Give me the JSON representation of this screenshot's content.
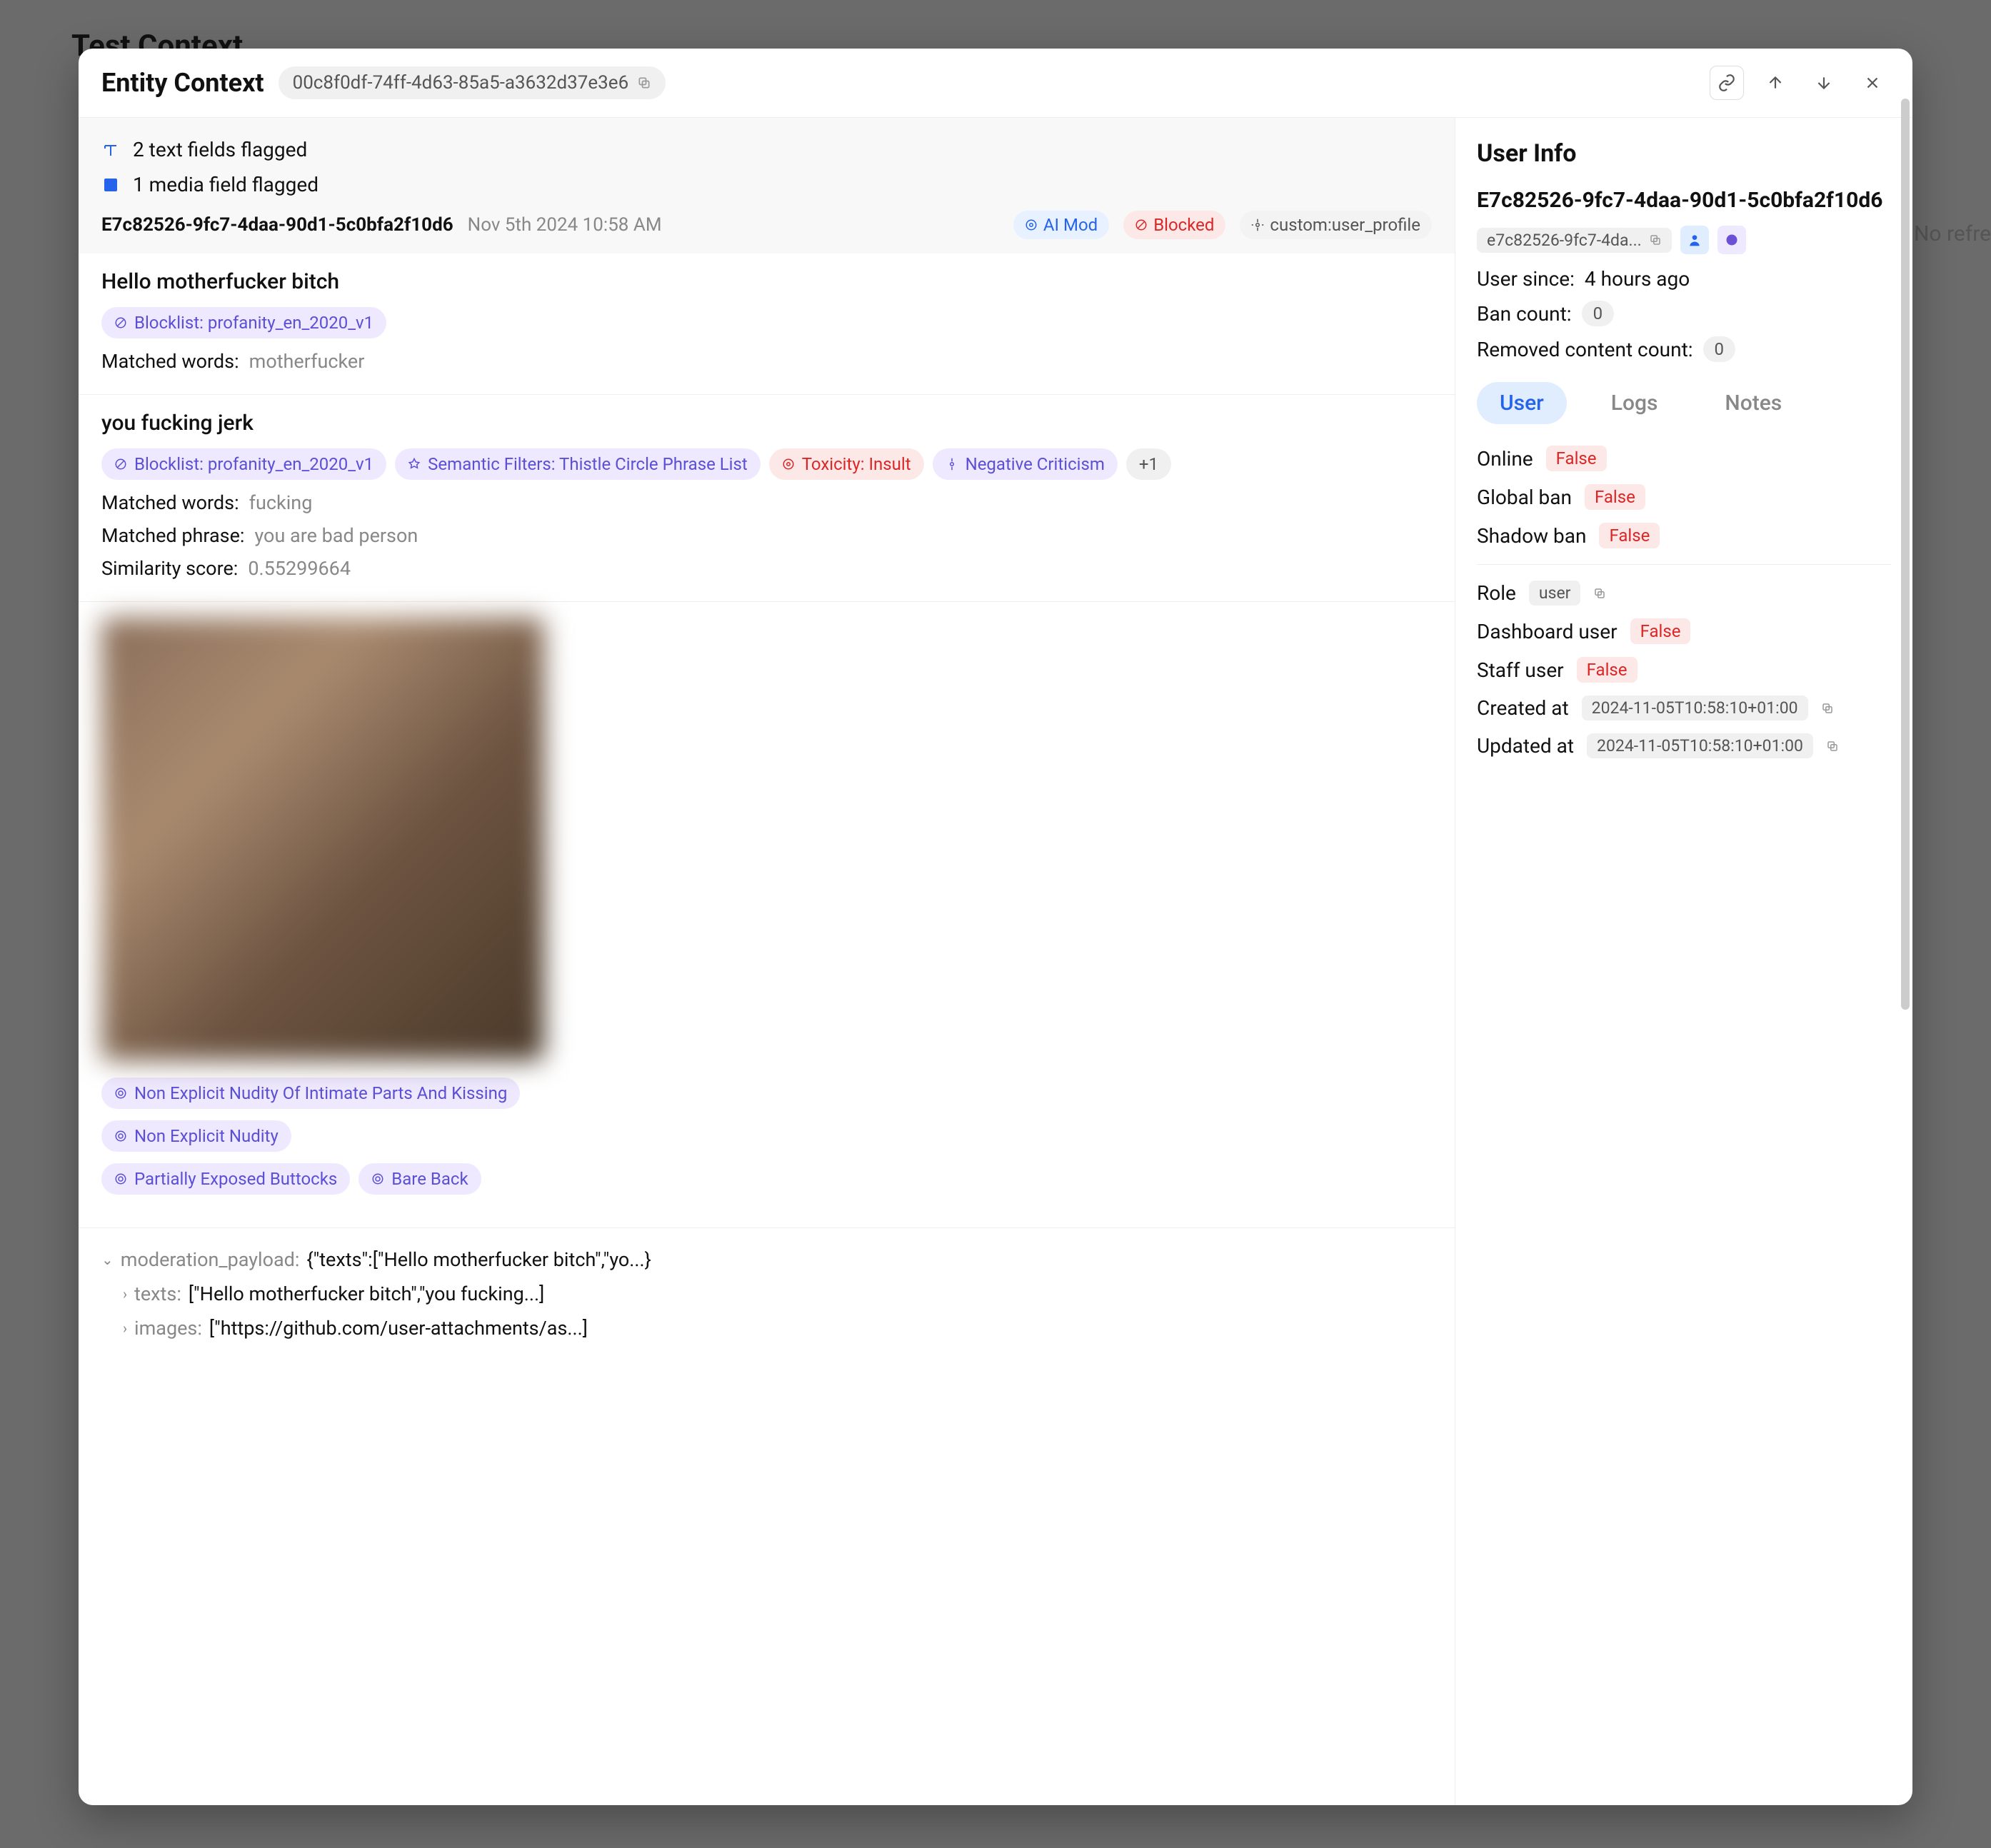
{
  "bg": {
    "title": "Test Context",
    "no_refresh": "No refre"
  },
  "header": {
    "title": "Entity Context",
    "id_pill": "00c8f0df-74ff-4d63-85a5-a3632d37e3e6"
  },
  "flags": {
    "text_flag": "2 text fields flagged",
    "media_flag": "1 media field flagged"
  },
  "meta": {
    "id": "E7c82526-9fc7-4daa-90d1-5c0bfa2f10d6",
    "date": "Nov 5th 2024 10:58 AM",
    "ai_mod": "AI Mod",
    "blocked": "Blocked",
    "custom": "custom:user_profile"
  },
  "section1": {
    "text": "Hello motherfucker bitch",
    "blocklist": "Blocklist: profanity_en_2020_v1",
    "matched_label": "Matched words:",
    "matched_value": "motherfucker"
  },
  "section2": {
    "text": "you fucking jerk",
    "blocklist": "Blocklist: profanity_en_2020_v1",
    "semantic": "Semantic Filters: Thistle Circle Phrase List",
    "toxicity": "Toxicity: Insult",
    "negative": "Negative Criticism",
    "plus": "+1",
    "matched_words_label": "Matched words:",
    "matched_words_value": "fucking",
    "matched_phrase_label": "Matched phrase:",
    "matched_phrase_value": "you are bad person",
    "similarity_label": "Similarity score:",
    "similarity_value": "0.55299664"
  },
  "section3": {
    "tag1": "Non Explicit Nudity Of Intimate Parts And Kissing",
    "tag2": "Non Explicit Nudity",
    "tag3": "Partially Exposed Buttocks",
    "tag4": "Bare Back"
  },
  "payload": {
    "key": "moderation_payload:",
    "val": "{\"texts\":[\"Hello motherfucker bitch\",\"yo...}",
    "texts_key": "texts:",
    "texts_val": "[\"Hello motherfucker bitch\",\"you fucking...]",
    "images_key": "images:",
    "images_val": "[\"https://github.com/user-attachments/as...]"
  },
  "sidebar": {
    "title": "User Info",
    "hash": "E7c82526-9fc7-4daa-90d1-5c0bfa2f10d6",
    "short_id": "e7c82526-9fc7-4da...",
    "user_since_label": "User since:",
    "user_since_value": "4 hours ago",
    "ban_count_label": "Ban count:",
    "ban_count_value": "0",
    "removed_label": "Removed content count:",
    "removed_value": "0",
    "tabs": {
      "user": "User",
      "logs": "Logs",
      "notes": "Notes"
    },
    "online_label": "Online",
    "online_value": "False",
    "global_ban_label": "Global ban",
    "global_ban_value": "False",
    "shadow_ban_label": "Shadow ban",
    "shadow_ban_value": "False",
    "role_label": "Role",
    "role_value": "user",
    "dashboard_label": "Dashboard user",
    "dashboard_value": "False",
    "staff_label": "Staff user",
    "staff_value": "False",
    "created_label": "Created at",
    "created_value": "2024-11-05T10:58:10+01:00",
    "updated_label": "Updated at",
    "updated_value": "2024-11-05T10:58:10+01:00"
  }
}
